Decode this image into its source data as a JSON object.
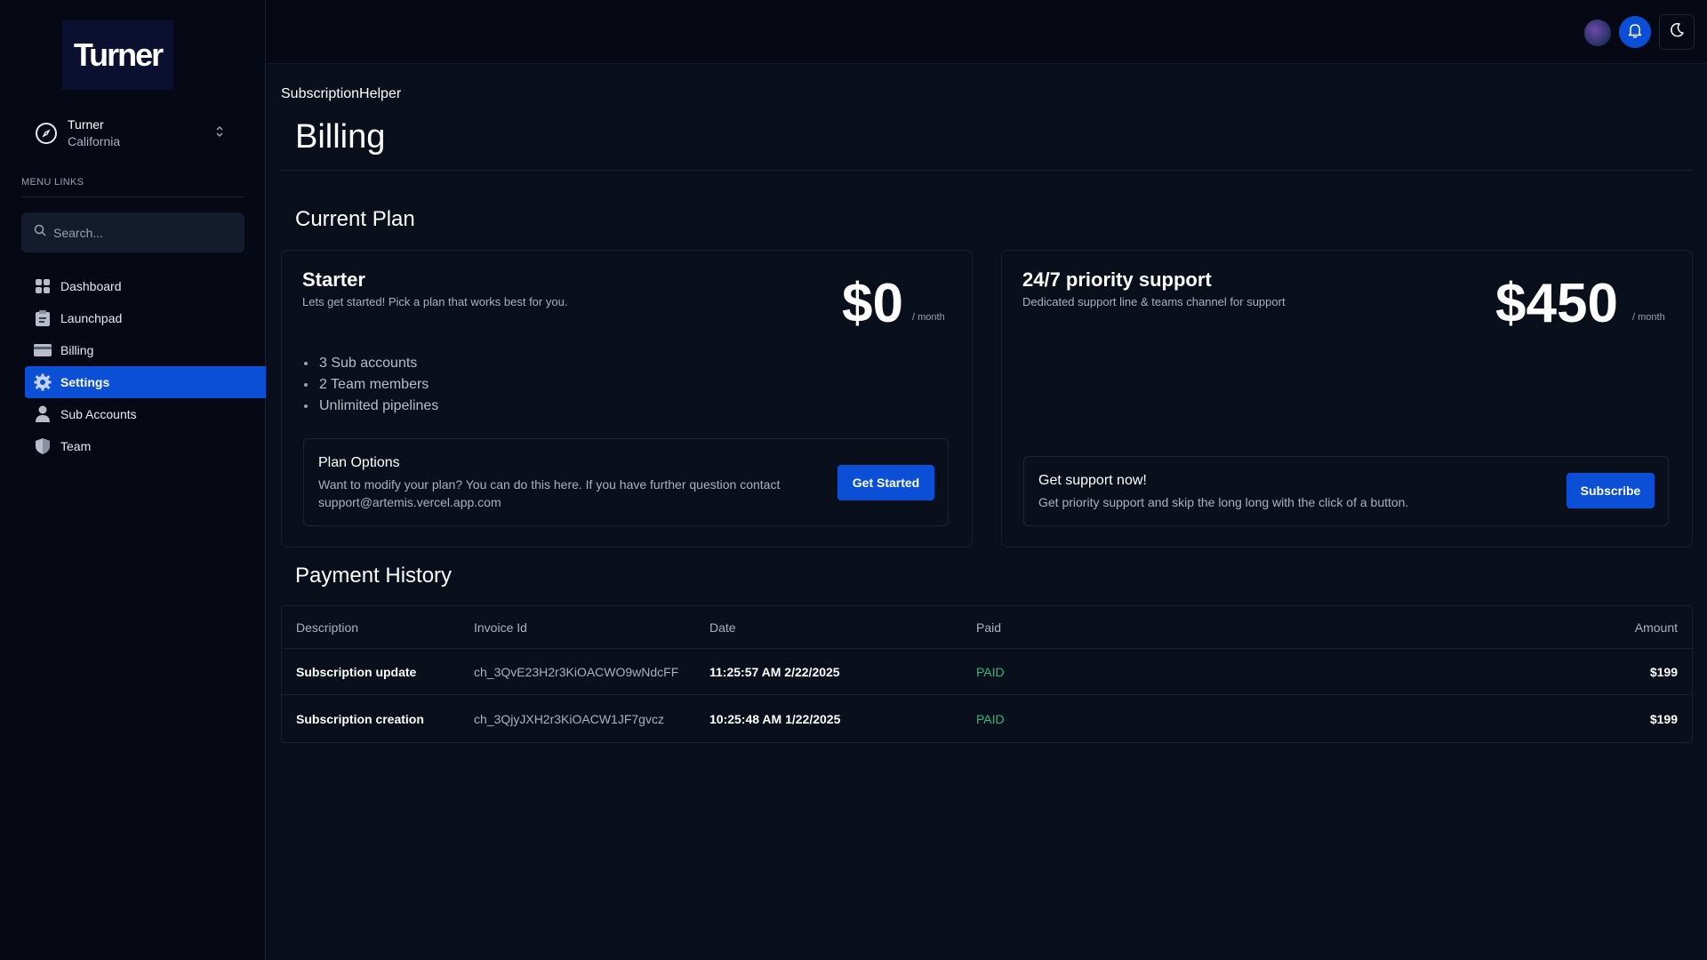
{
  "sidebar": {
    "logo_text": "Turner",
    "account": {
      "name": "Turner",
      "location": "California"
    },
    "menu_label": "MENU LINKS",
    "search_placeholder": "Search...",
    "items": [
      {
        "label": "Dashboard",
        "icon": "dashboard-icon"
      },
      {
        "label": "Launchpad",
        "icon": "clipboard-icon"
      },
      {
        "label": "Billing",
        "icon": "credit-card-icon"
      },
      {
        "label": "Settings",
        "icon": "gear-icon",
        "active": true
      },
      {
        "label": "Sub Accounts",
        "icon": "person-icon"
      },
      {
        "label": "Team",
        "icon": "shield-icon"
      }
    ]
  },
  "header": {
    "breadcrumb": "SubscriptionHelper",
    "title": "Billing"
  },
  "current_plan": {
    "section_title": "Current Plan",
    "starter": {
      "name": "Starter",
      "description": "Lets get started! Pick a plan that works best for you.",
      "price": "$0",
      "period": "/ month",
      "features": [
        "3 Sub accounts",
        "2 Team members",
        "Unlimited pipelines"
      ],
      "options_title": "Plan Options",
      "options_desc_line1": "Want to modify your plan? You can do this here. If you have further question contact",
      "options_desc_line2": "support@artemis.vercel.app.com",
      "button": "Get Started"
    },
    "support": {
      "name": "24/7 priority support",
      "description": "Dedicated support line & teams channel for support",
      "price": "$450",
      "period": "/ month",
      "box_title": "Get support now!",
      "box_desc": "Get priority support and skip the long long with the click of a button.",
      "button": "Subscribe"
    }
  },
  "payment_history": {
    "section_title": "Payment History",
    "columns": [
      "Description",
      "Invoice Id",
      "Date",
      "Paid",
      "Amount"
    ],
    "rows": [
      {
        "description": "Subscription update",
        "invoice": "ch_3QvE23H2r3KiOACWO9wNdcFF",
        "date": "11:25:57 AM 2/22/2025",
        "paid": "PAID",
        "amount": "$199"
      },
      {
        "description": "Subscription creation",
        "invoice": "ch_3QjyJXH2r3KiOACW1JF7gvcz",
        "date": "10:25:48 AM 1/22/2025",
        "paid": "PAID",
        "amount": "$199"
      }
    ]
  },
  "colors": {
    "accent": "#0b4fd6",
    "paid": "#22c07a",
    "background": "#0a0f1c"
  }
}
